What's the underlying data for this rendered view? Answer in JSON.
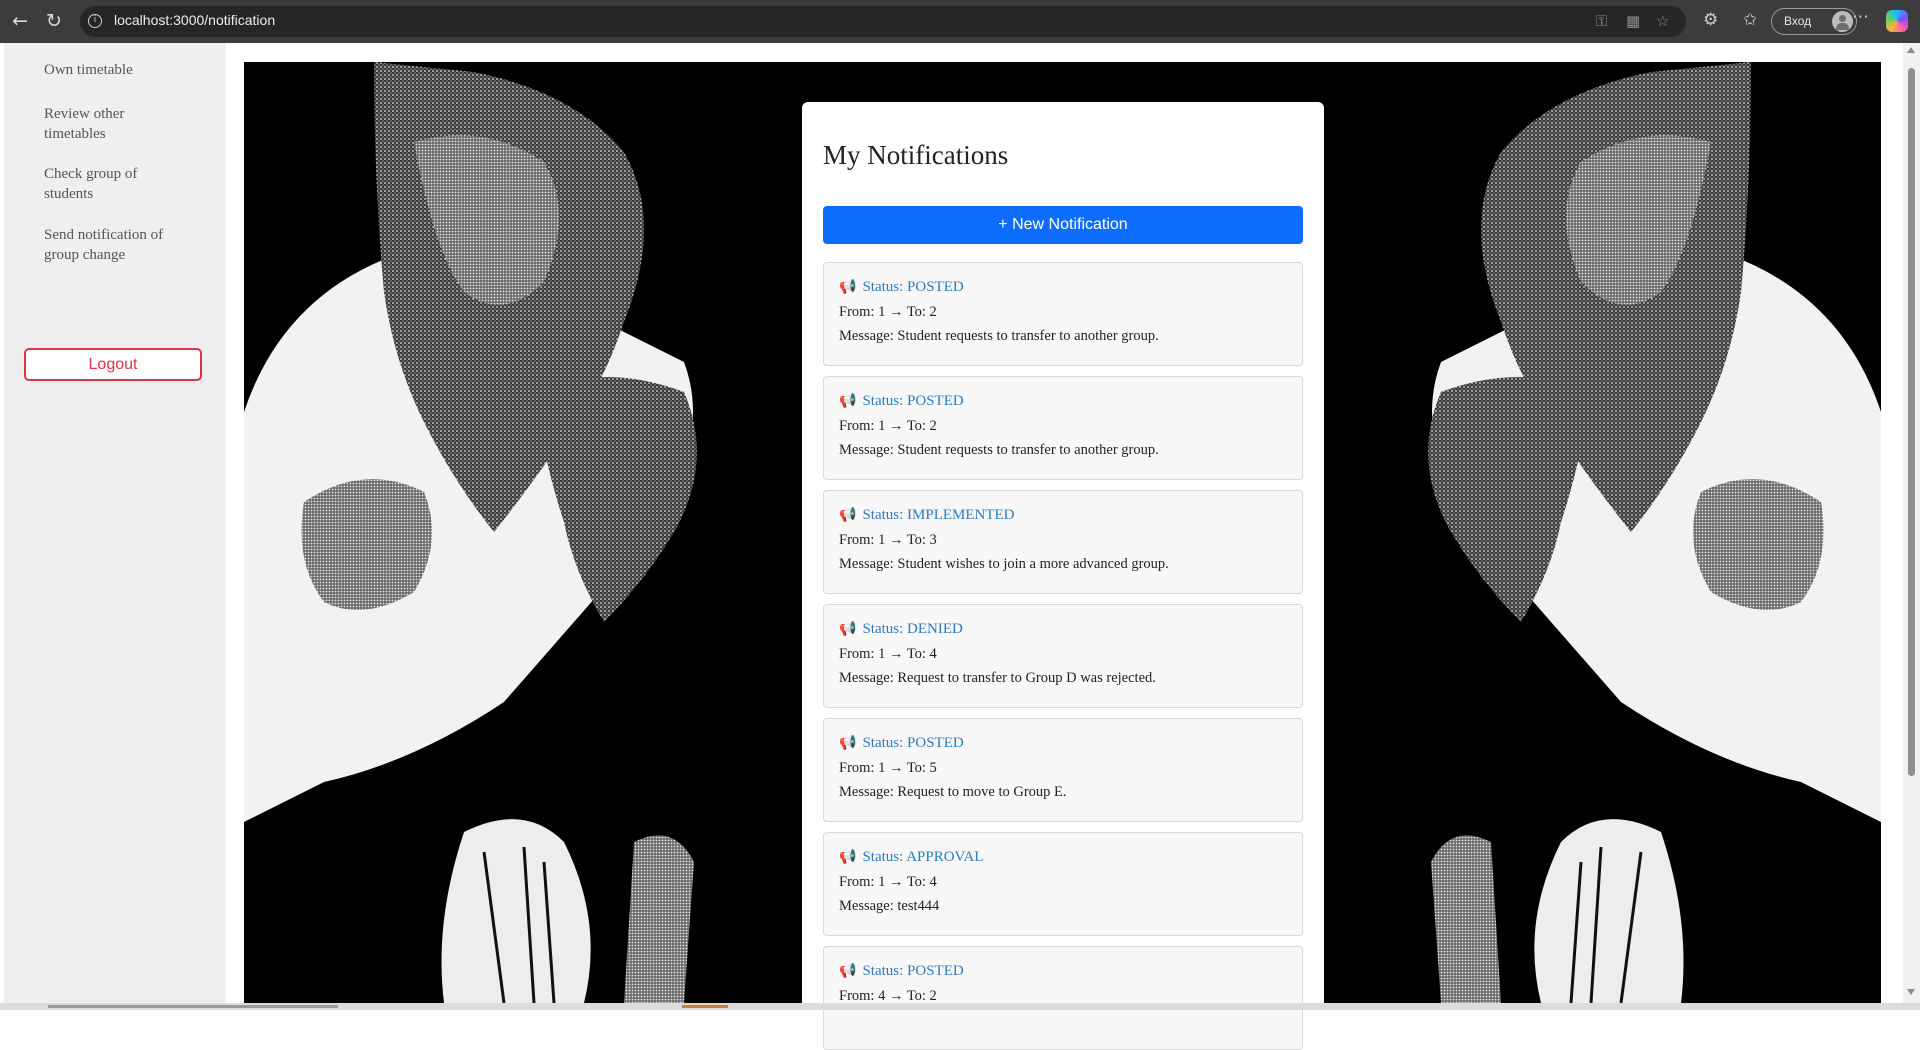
{
  "browser": {
    "url": "localhost:3000/notification",
    "signin_label": "Вход",
    "icons": [
      "back-icon",
      "reload-icon",
      "info-icon",
      "key-icon",
      "app-icon",
      "star-icon",
      "extensions-icon",
      "favorites-icon",
      "more-icon",
      "copilot-icon"
    ]
  },
  "sidebar": {
    "items": [
      {
        "label": "Own timetable"
      },
      {
        "label": "Review other timetables"
      },
      {
        "label": "Check group of students"
      },
      {
        "label": "Send notification of group change"
      }
    ],
    "logout_label": "Logout",
    "logout_color": "#dc3545"
  },
  "main": {
    "title": "My Notifications",
    "new_button_label": "+ New Notification",
    "accent_color": "#0d6efd",
    "notifications": [
      {
        "status": "Status: POSTED",
        "route": "From: 1 → To: 2",
        "message": "Message: Student requests to transfer to another group."
      },
      {
        "status": "Status: POSTED",
        "route": "From: 1 → To: 2",
        "message": "Message: Student requests to transfer to another group."
      },
      {
        "status": "Status: IMPLEMENTED",
        "route": "From: 1 → To: 3",
        "message": "Message: Student wishes to join a more advanced group."
      },
      {
        "status": "Status: DENIED",
        "route": "From: 1 → To: 4",
        "message": "Message: Request to transfer to Group D was rejected."
      },
      {
        "status": "Status: POSTED",
        "route": "From: 1 → To: 5",
        "message": "Message: Request to move to Group E."
      },
      {
        "status": "Status: APPROVAL",
        "route": "From: 1 → To: 4",
        "message": "Message: test444"
      },
      {
        "status": "Status: POSTED",
        "route": "From: 4 → To: 2",
        "message": ""
      }
    ]
  }
}
